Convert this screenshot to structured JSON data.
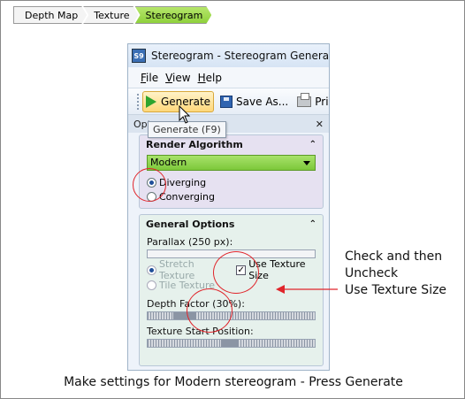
{
  "breadcrumb": [
    "Depth Map",
    "Texture",
    "Stereogram"
  ],
  "window": {
    "icon_text": "S9",
    "title": "Stereogram - Stereogram Generator"
  },
  "menu": [
    "File",
    "View",
    "Help"
  ],
  "toolbar": {
    "generate": "Generate",
    "save": "Save As...",
    "print": "Print..."
  },
  "tooltip": "Generate (F9)",
  "panel_header": "Opt",
  "render": {
    "title": "Render Algorithm",
    "algorithm": "Modern",
    "options": [
      "Diverging",
      "Converging"
    ],
    "selected": "Diverging"
  },
  "general": {
    "title": "General Options",
    "parallax_label": "Parallax (250 px):",
    "stretch": "Stretch Texture",
    "tile": "Tile Texture",
    "use_size": "Use Texture Size",
    "use_size_checked": true,
    "depth_label": "Depth Factor (30%):",
    "depth_value": 0.3,
    "start_label": "Texture Start Position:"
  },
  "annotation": {
    "line1": "Check and then",
    "line2": "Uncheck",
    "line3": "Use Texture Size"
  },
  "caption": "Make settings for Modern stereogram - Press Generate",
  "colors": {
    "highlight": "#e0252b",
    "active_tab": "#8fd13c",
    "combo": "#7cc83a"
  }
}
